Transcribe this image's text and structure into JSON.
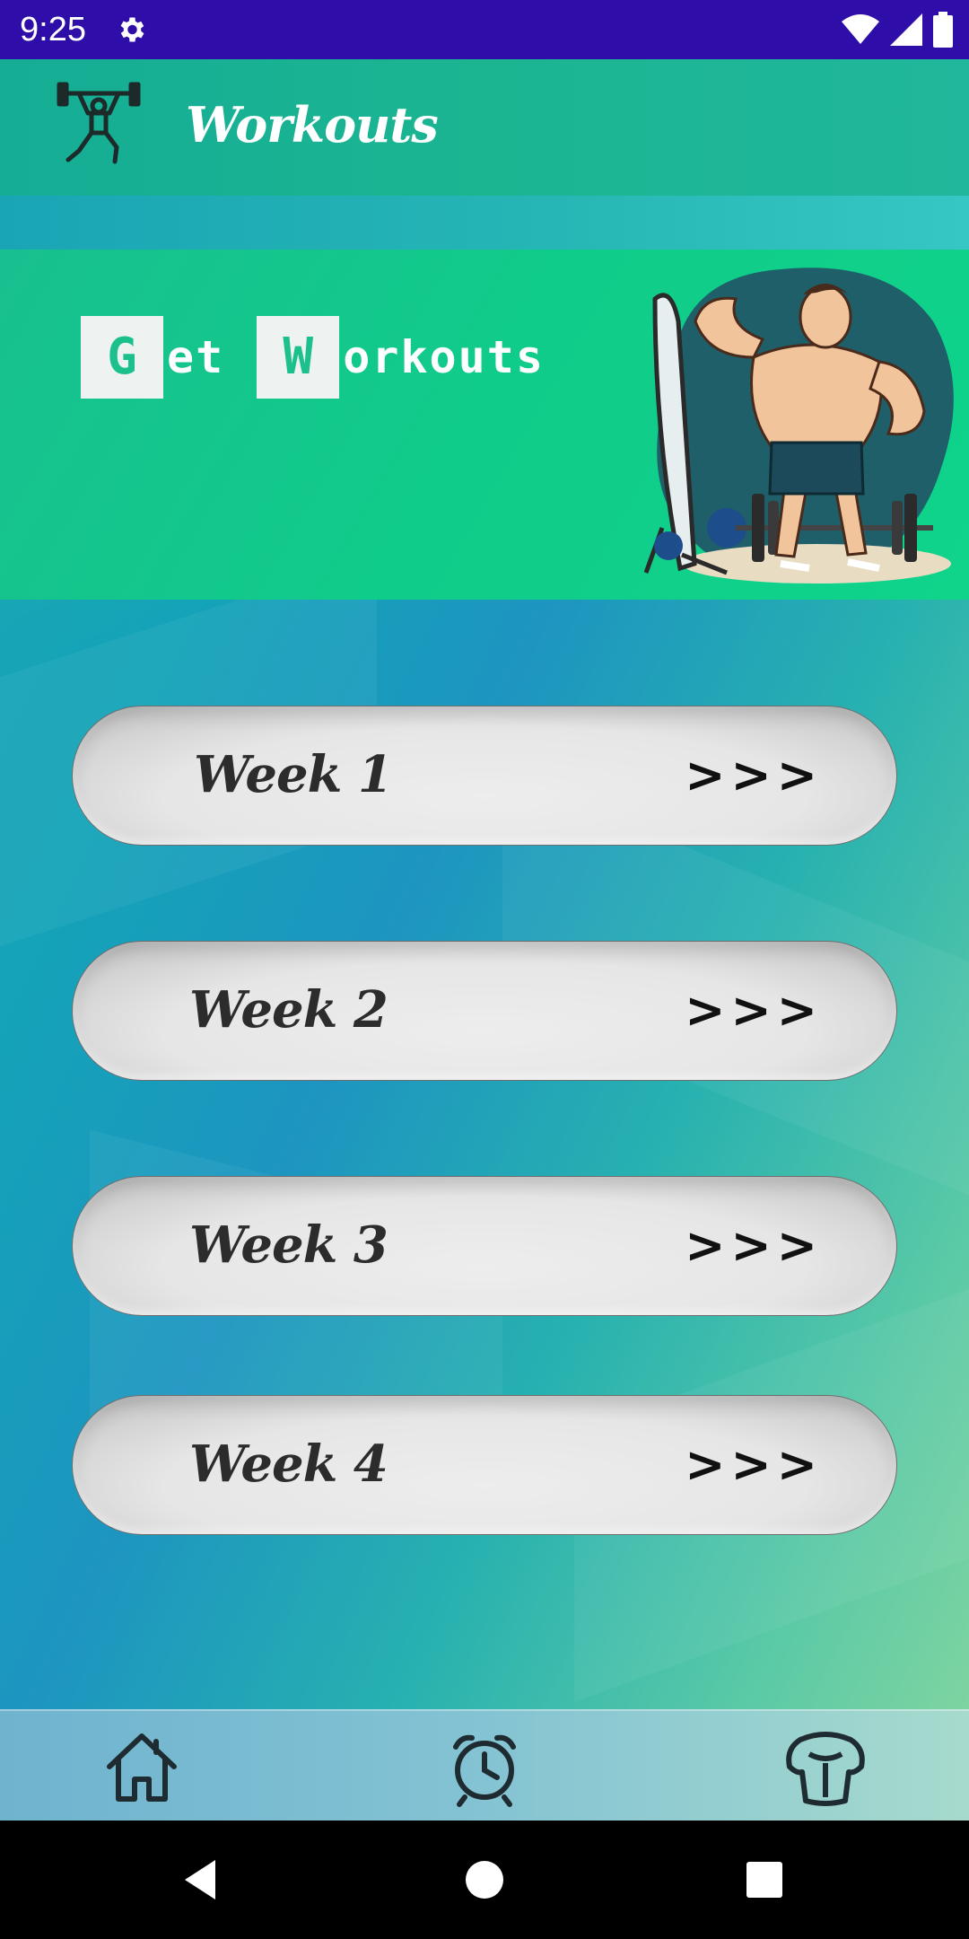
{
  "status_bar": {
    "time": "9:25",
    "icons": [
      "gear-icon",
      "wifi-icon",
      "signal-icon",
      "battery-icon"
    ]
  },
  "toolbar": {
    "title": "Workouts",
    "icon": "weightlifter-icon"
  },
  "banner": {
    "first_letter_1": "G",
    "rest_1": "et",
    "first_letter_2": "W",
    "rest_2": "orkouts",
    "image": "bodybuilder-mirror-illustration"
  },
  "weeks": [
    {
      "label": "Week 1",
      "arrows": ">>>"
    },
    {
      "label": "Week 2",
      "arrows": ">>>"
    },
    {
      "label": "Week 3",
      "arrows": ">>>"
    },
    {
      "label": "Week 4",
      "arrows": ">>>"
    }
  ],
  "bottom_nav": {
    "items": [
      "home-icon",
      "alarm-clock-icon",
      "muscle-torso-icon"
    ]
  },
  "system_nav": {
    "buttons": [
      "back-icon",
      "home-circle-icon",
      "recents-icon"
    ]
  },
  "colors": {
    "status_bar": "#2E0DA8",
    "toolbar": "#1BB592",
    "banner": "#10CC8A",
    "button": "#E6E6E6"
  }
}
